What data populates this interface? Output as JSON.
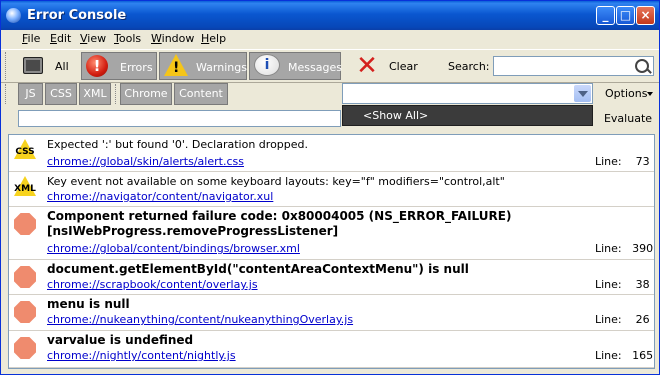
{
  "window": {
    "title": "Error Console"
  },
  "menu": [
    {
      "label": "File",
      "u": "F",
      "rest": "ile"
    },
    {
      "label": "Edit",
      "u": "E",
      "rest": "dit"
    },
    {
      "label": "View",
      "u": "V",
      "rest": "iew"
    },
    {
      "label": "Tools",
      "u": "T",
      "rest": "ools"
    },
    {
      "label": "Window",
      "u": "W",
      "rest": "indow"
    },
    {
      "label": "Help",
      "u": "H",
      "rest": "elp"
    }
  ],
  "toolbar": {
    "all_label": "All",
    "errors_label": "Errors",
    "warnings_label": "Warnings",
    "messages_label": "Messages",
    "clear_label": "Clear",
    "search_label": "Search:",
    "search_value": ""
  },
  "filters": [
    "JS",
    "CSS",
    "XML",
    "Chrome",
    "Content"
  ],
  "options_label": "Options",
  "evaluate_label": "Evaluate",
  "eval_value": "",
  "dropdown_item": "<Show All>",
  "entries": [
    {
      "type": "css",
      "message": "Expected ':' but found '0'.  Declaration dropped.",
      "source": "chrome://global/skin/alerts/alert.css",
      "line_label": "Line:",
      "line": "73"
    },
    {
      "type": "xml",
      "message": "Key event not available on some keyboard layouts: key=\"f\" modifiers=\"control,alt\"",
      "source": "chrome://navigator/content/navigator.xul",
      "line_label": "",
      "line": ""
    },
    {
      "type": "error",
      "message": "Component returned failure code: 0x80004005 (NS_ERROR_FAILURE) [nsIWebProgress.removeProgressListener]",
      "source": "chrome://global/content/bindings/browser.xml",
      "line_label": "Line:",
      "line": "390"
    },
    {
      "type": "error",
      "message": "document.getElementById(\"contentAreaContextMenu\") is null",
      "source": "chrome://scrapbook/content/overlay.js",
      "line_label": "Line:",
      "line": "38"
    },
    {
      "type": "error",
      "message": "menu is null",
      "source": "chrome://nukeanything/content/nukeanythingOverlay.js",
      "line_label": "Line:",
      "line": "26"
    },
    {
      "type": "error",
      "message": "varvalue is undefined",
      "source": "chrome://nightly/content/nightly.js",
      "line_label": "Line:",
      "line": "165"
    }
  ]
}
